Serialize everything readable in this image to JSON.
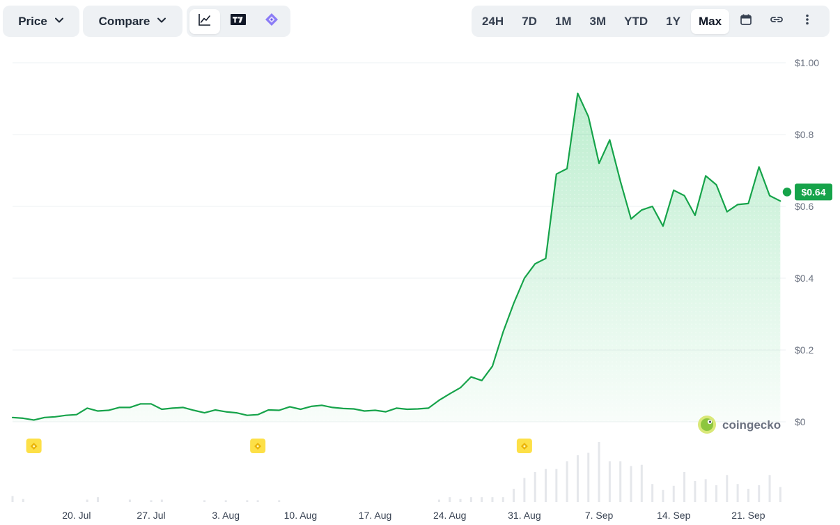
{
  "toolbar": {
    "price_label": "Price",
    "compare_label": "Compare",
    "chart_type_buttons": [
      {
        "icon": "line-chart-icon",
        "active": true
      },
      {
        "icon": "tradingview-icon",
        "active": false
      },
      {
        "icon": "diamond-icon",
        "active": false
      }
    ],
    "ranges": [
      "24H",
      "7D",
      "1M",
      "3M",
      "YTD",
      "1Y",
      "Max"
    ],
    "active_range": "Max",
    "extra_icons": [
      "calendar-icon",
      "link-icon",
      "more-vertical-icon"
    ]
  },
  "colors": {
    "line": "#16a34a",
    "fill": "#22c55e",
    "tag": "#16a34a",
    "volume": "#e5e7eb",
    "grid": "#eef0f3",
    "event_marker": "#fde047"
  },
  "watermark": "coingecko",
  "current_price_label": "$0.64",
  "chart_data": {
    "type": "area",
    "y_ticks": [
      "$1.00",
      "$0.8",
      "$0.6",
      "$0.4",
      "$0.2",
      "$0"
    ],
    "ylim": [
      0,
      1.0
    ],
    "x_ticks": [
      "20. Jul",
      "27. Jul",
      "3. Aug",
      "10. Aug",
      "17. Aug",
      "24. Aug",
      "31. Aug",
      "7. Sep",
      "14. Sep",
      "21. Sep"
    ],
    "x_start": "2024-07-14",
    "x_tick_days": [
      6,
      13,
      20,
      27,
      34,
      41,
      48,
      55,
      62,
      69
    ],
    "x_end_day": 72.5,
    "price_series": {
      "days": [
        0,
        1,
        2,
        3,
        4,
        5,
        6,
        7,
        8,
        9,
        10,
        11,
        12,
        13,
        14,
        15,
        16,
        17,
        18,
        19,
        20,
        21,
        22,
        23,
        24,
        25,
        26,
        27,
        28,
        29,
        30,
        31,
        32,
        33,
        34,
        35,
        36,
        37,
        38,
        39,
        40,
        41,
        42,
        43,
        44,
        45,
        46,
        47,
        48,
        49,
        50,
        51,
        52,
        53,
        54,
        55,
        56,
        57,
        58,
        59,
        60,
        61,
        62,
        63,
        64,
        65,
        66,
        67,
        68,
        69,
        70,
        71,
        72
      ],
      "values": [
        0.012,
        0.01,
        0.005,
        0.012,
        0.014,
        0.018,
        0.02,
        0.038,
        0.03,
        0.032,
        0.04,
        0.04,
        0.05,
        0.05,
        0.035,
        0.038,
        0.04,
        0.032,
        0.025,
        0.033,
        0.028,
        0.025,
        0.018,
        0.02,
        0.033,
        0.032,
        0.042,
        0.035,
        0.043,
        0.046,
        0.04,
        0.037,
        0.036,
        0.03,
        0.032,
        0.028,
        0.038,
        0.035,
        0.036,
        0.038,
        0.06,
        0.078,
        0.095,
        0.125,
        0.115,
        0.155,
        0.25,
        0.33,
        0.4,
        0.44,
        0.455,
        0.69,
        0.705,
        0.915,
        0.85,
        0.72,
        0.785,
        0.67,
        0.565,
        0.59,
        0.6,
        0.545,
        0.645,
        0.63,
        0.575,
        0.685,
        0.66,
        0.585,
        0.605,
        0.608,
        0.71,
        0.63,
        0.615
      ]
    },
    "current_value": 0.64,
    "volume_series": {
      "days": [
        0,
        1,
        7,
        8,
        11,
        13,
        14,
        18,
        20,
        22,
        23,
        25,
        40,
        41,
        42,
        43,
        44,
        45,
        46,
        47,
        48,
        49,
        50,
        51,
        52,
        53,
        54,
        55,
        56,
        57,
        58,
        59,
        60,
        61,
        62,
        63,
        64,
        65,
        66,
        67,
        68,
        69,
        70,
        71,
        72
      ],
      "values": [
        0.1,
        0.05,
        0.04,
        0.08,
        0.04,
        0.03,
        0.04,
        0.03,
        0.03,
        0.03,
        0.03,
        0.03,
        0.04,
        0.08,
        0.05,
        0.08,
        0.08,
        0.08,
        0.08,
        0.22,
        0.4,
        0.5,
        0.55,
        0.55,
        0.68,
        0.78,
        0.82,
        1.0,
        0.68,
        0.68,
        0.6,
        0.62,
        0.3,
        0.2,
        0.27,
        0.5,
        0.35,
        0.38,
        0.28,
        0.45,
        0.3,
        0.22,
        0.28,
        0.45,
        0.25
      ]
    },
    "event_markers_days": [
      2,
      23,
      48
    ]
  }
}
